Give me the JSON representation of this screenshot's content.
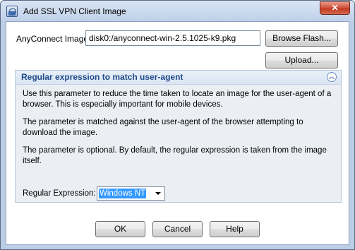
{
  "window": {
    "title": "Add SSL VPN Client Image",
    "icon": "vpn-lock-icon",
    "close_glyph": "✕"
  },
  "form": {
    "image_label": "AnyConnect Image:",
    "image_value": "disk0:/anyconnect-win-2.5.1025-k9.pkg",
    "browse_label": "Browse Flash...",
    "upload_label": "Upload..."
  },
  "panel": {
    "title": "Regular expression to match user-agent",
    "collapse_icon": "collapse-up-icon",
    "collapse_glyph": "︽",
    "paragraphs": [
      "Use this parameter to reduce the time taken to locate an image for the user-agent of a browser. This is especially important for mobile devices.",
      "The parameter is matched against the user-agent of the browser attempting to download the image.",
      "The parameter is optional. By default, the regular expression is taken from the image itself."
    ],
    "regex_label": "Regular Expression:",
    "regex_value": "Windows NT"
  },
  "footer": {
    "ok_label": "OK",
    "cancel_label": "Cancel",
    "help_label": "Help"
  },
  "colors": {
    "panel_title": "#1f4a8a",
    "selection": "#3399ff",
    "close_button": "#c23a22"
  }
}
